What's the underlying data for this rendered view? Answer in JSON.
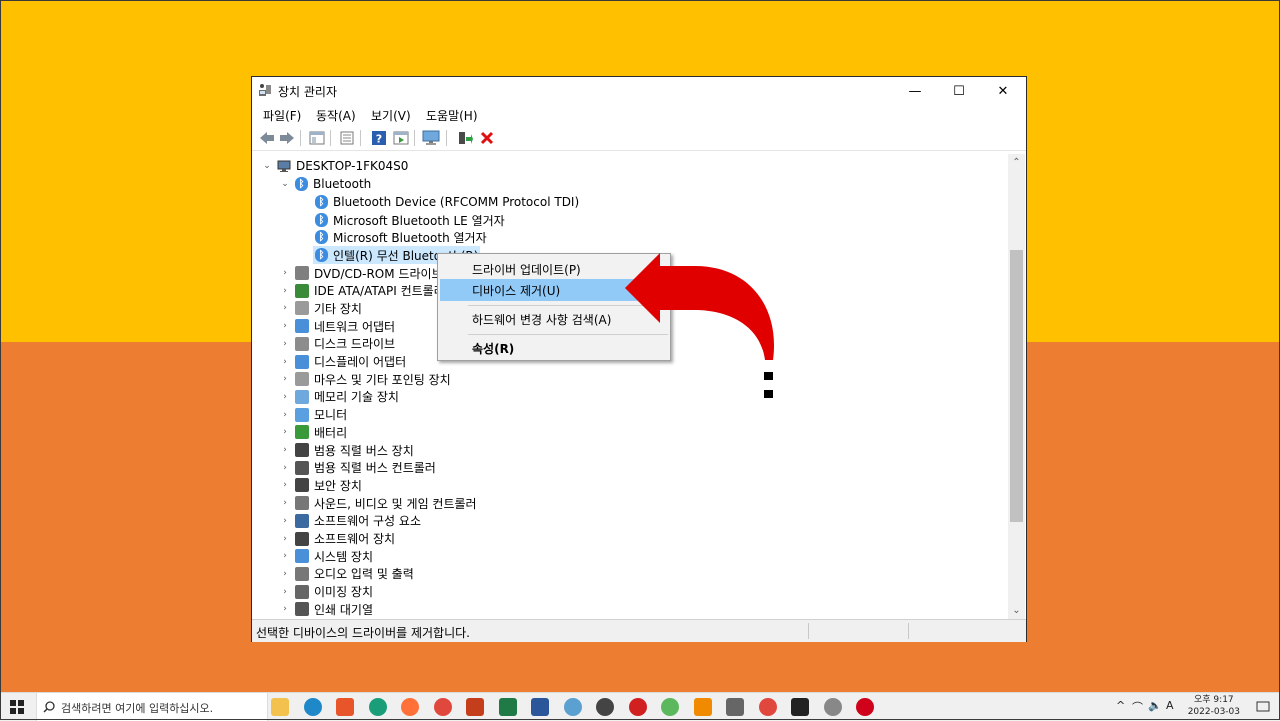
{
  "window": {
    "title": "장치 관리자",
    "controls": {
      "minimize": "—",
      "maximize": "☐",
      "close": "✕"
    }
  },
  "menubar": [
    "파일(F)",
    "동작(A)",
    "보기(V)",
    "도움말(H)"
  ],
  "tree": {
    "root": "DESKTOP-1FK04S0",
    "bluetooth": {
      "label": "Bluetooth",
      "children": [
        "Bluetooth Device (RFCOMM Protocol TDI)",
        "Microsoft Bluetooth LE 열거자",
        "Microsoft Bluetooth 열거자",
        "인텔(R) 무선 Bluetooth(R)"
      ]
    },
    "categories": [
      "DVD/CD-ROM 드라이브",
      "IDE ATA/ATAPI 컨트롤러",
      "기타 장치",
      "네트워크 어댑터",
      "디스크 드라이브",
      "디스플레이 어댑터",
      "마우스 및 기타 포인팅 장치",
      "메모리 기술 장치",
      "모니터",
      "배터리",
      "범용 직렬 버스 장치",
      "범용 직렬 버스 컨트롤러",
      "보안 장치",
      "사운드, 비디오 및 게임 컨트롤러",
      "소프트웨어 구성 요소",
      "소프트웨어 장치",
      "시스템 장치",
      "오디오 입력 및 출력",
      "이미징 장치",
      "인쇄 대기열"
    ]
  },
  "context_menu": {
    "items": [
      "드라이버 업데이트(P)",
      "디바이스 제거(U)",
      "하드웨어 변경 사항 검색(A)",
      "속성(R)"
    ],
    "highlighted_index": 1
  },
  "status": {
    "text": "선택한 디바이스의 드라이버를 제거합니다."
  },
  "taskbar": {
    "search_placeholder": "검색하려면 여기에 입력하십시오.",
    "time": "오후 9:17",
    "date": "2022-03-03",
    "input_mode": "A"
  },
  "colors": {
    "bg_top": "#ffc000",
    "bg_bottom": "#ed7d31",
    "arrow": "#e00000",
    "highlight": "#91c9f7"
  }
}
